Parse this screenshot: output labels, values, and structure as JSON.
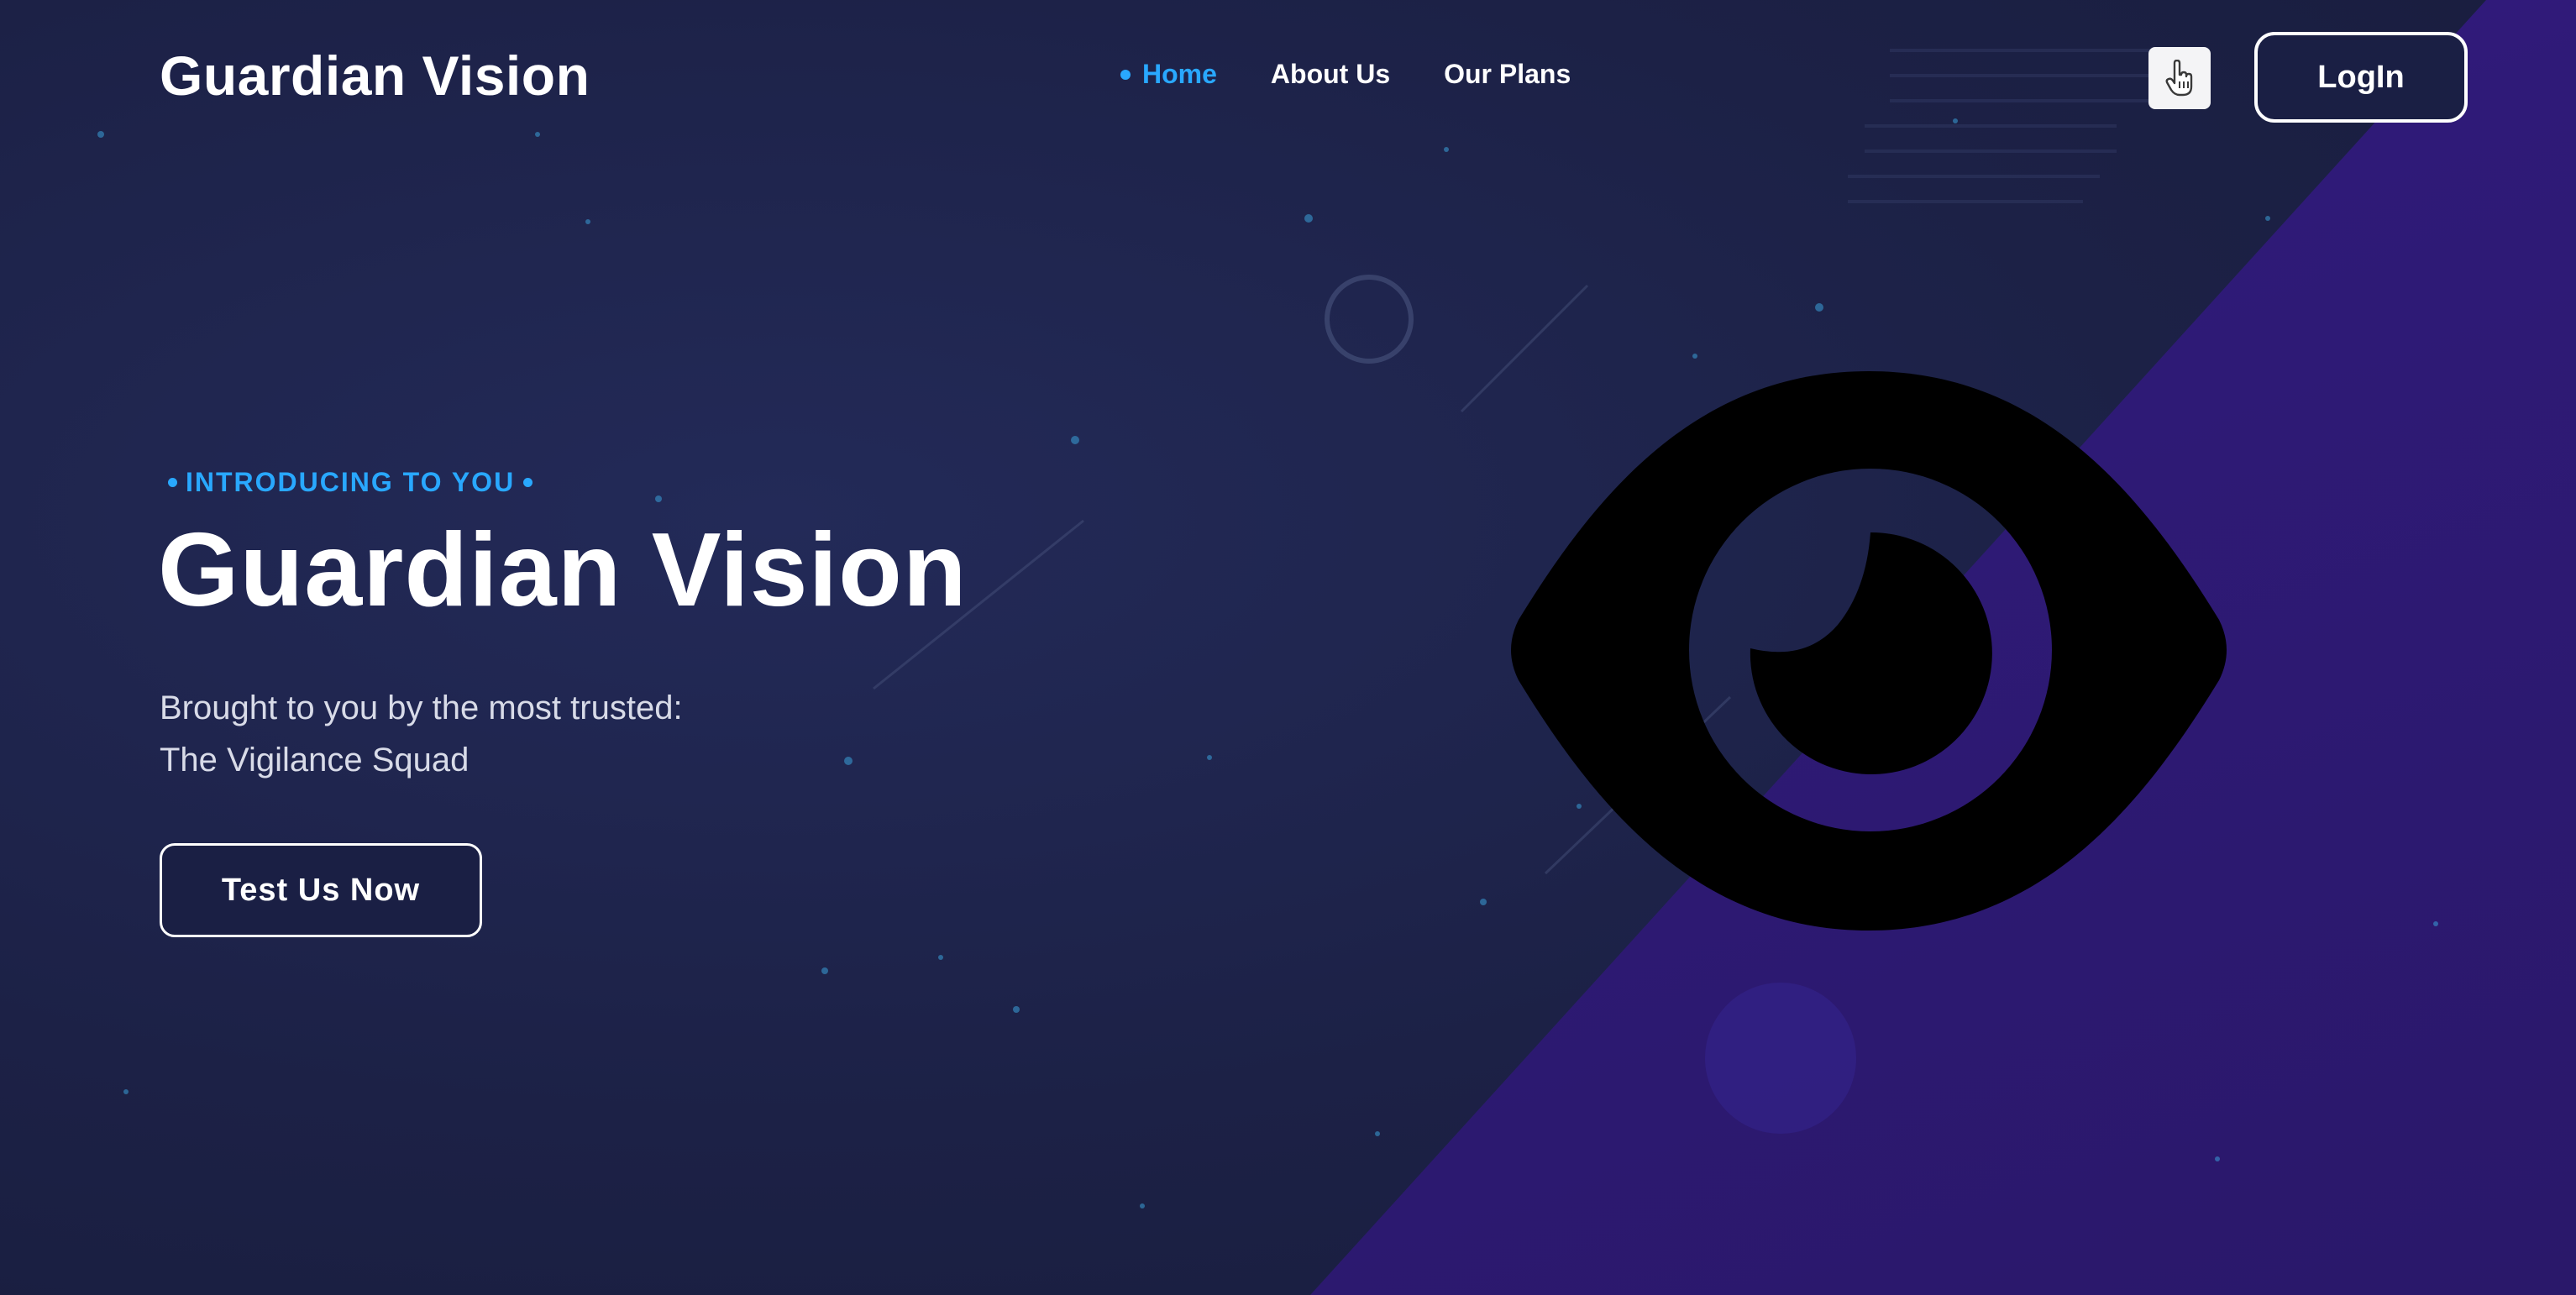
{
  "header": {
    "brand": "Guardian Vision",
    "nav": [
      {
        "label": "Home",
        "active": true
      },
      {
        "label": "About Us",
        "active": false
      },
      {
        "label": "Our Plans",
        "active": false
      }
    ],
    "icon_button_icon": "hand-pointer-icon",
    "login_label": "LogIn"
  },
  "hero": {
    "eyebrow": "INTRODUCING TO YOU",
    "title": "Guardian Vision",
    "subtitle_line1": "Brought to you by the most trusted:",
    "subtitle_line2": "The Vigilance Squad",
    "cta_label": "Test Us Now",
    "illustration": "eye-icon"
  },
  "colors": {
    "background": "#1c2146",
    "purple_accent": "#3a1a8a",
    "link_accent": "#29a8ff",
    "text": "#ffffff"
  }
}
